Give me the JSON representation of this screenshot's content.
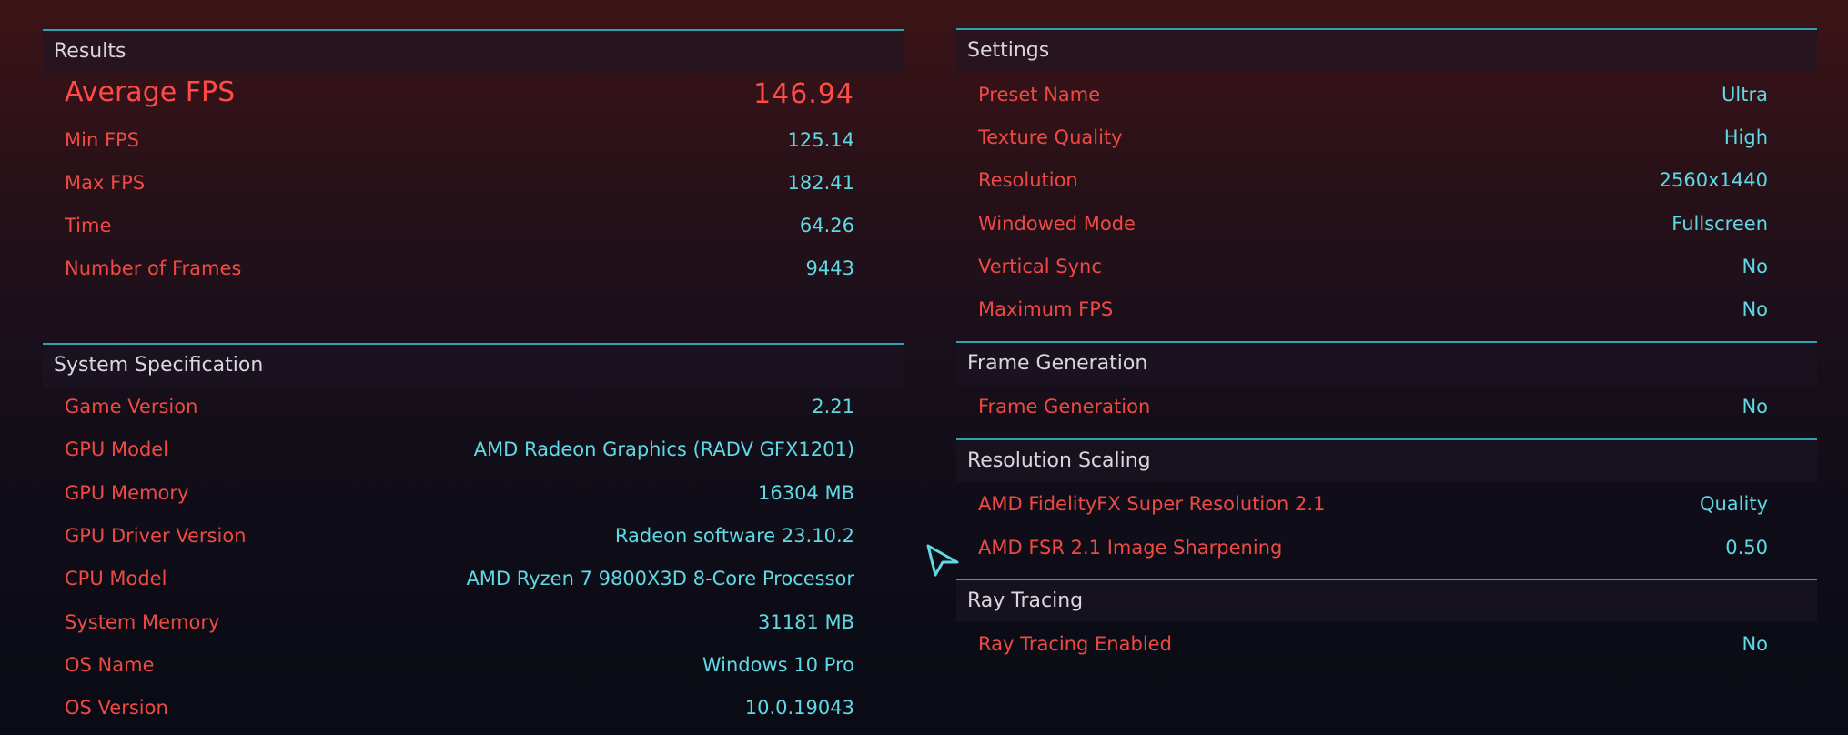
{
  "results": {
    "title": "Results",
    "average_fps": {
      "label": "Average FPS",
      "value": "146.94"
    },
    "rows": [
      {
        "label": "Min FPS",
        "value": "125.14"
      },
      {
        "label": "Max FPS",
        "value": "182.41"
      },
      {
        "label": "Time",
        "value": "64.26"
      },
      {
        "label": "Number of Frames",
        "value": "9443"
      }
    ]
  },
  "system_specification": {
    "title": "System Specification",
    "rows": [
      {
        "label": "Game Version",
        "value": "2.21"
      },
      {
        "label": "GPU Model",
        "value": "AMD Radeon Graphics (RADV GFX1201)"
      },
      {
        "label": "GPU Memory",
        "value": "16304 MB"
      },
      {
        "label": "GPU Driver Version",
        "value": "Radeon software 23.10.2"
      },
      {
        "label": "CPU Model",
        "value": "AMD Ryzen 7 9800X3D 8-Core Processor"
      },
      {
        "label": "System Memory",
        "value": "31181 MB"
      },
      {
        "label": "OS Name",
        "value": "Windows 10 Pro"
      },
      {
        "label": "OS Version",
        "value": "10.0.19043"
      }
    ]
  },
  "settings": {
    "title": "Settings",
    "rows": [
      {
        "label": "Preset Name",
        "value": "Ultra"
      },
      {
        "label": "Texture Quality",
        "value": "High"
      },
      {
        "label": "Resolution",
        "value": "2560x1440"
      },
      {
        "label": "Windowed Mode",
        "value": "Fullscreen"
      },
      {
        "label": "Vertical Sync",
        "value": "No"
      },
      {
        "label": "Maximum FPS",
        "value": "No"
      }
    ]
  },
  "frame_generation": {
    "title": "Frame Generation",
    "rows": [
      {
        "label": "Frame Generation",
        "value": "No"
      }
    ]
  },
  "resolution_scaling": {
    "title": "Resolution Scaling",
    "rows": [
      {
        "label": "AMD FidelityFX Super Resolution 2.1",
        "value": "Quality"
      },
      {
        "label": "AMD FSR 2.1 Image Sharpening",
        "value": "0.50"
      }
    ]
  },
  "ray_tracing": {
    "title": "Ray Tracing",
    "rows": [
      {
        "label": "Ray Tracing Enabled",
        "value": "No"
      }
    ]
  },
  "colors": {
    "label_red": "#ee4a43",
    "value_cyan": "#5fd9e4",
    "accent_line": "#2fa3ad",
    "header_text": "#d9d6dc"
  },
  "icons": {
    "cursor": "arrow-cursor-icon"
  }
}
